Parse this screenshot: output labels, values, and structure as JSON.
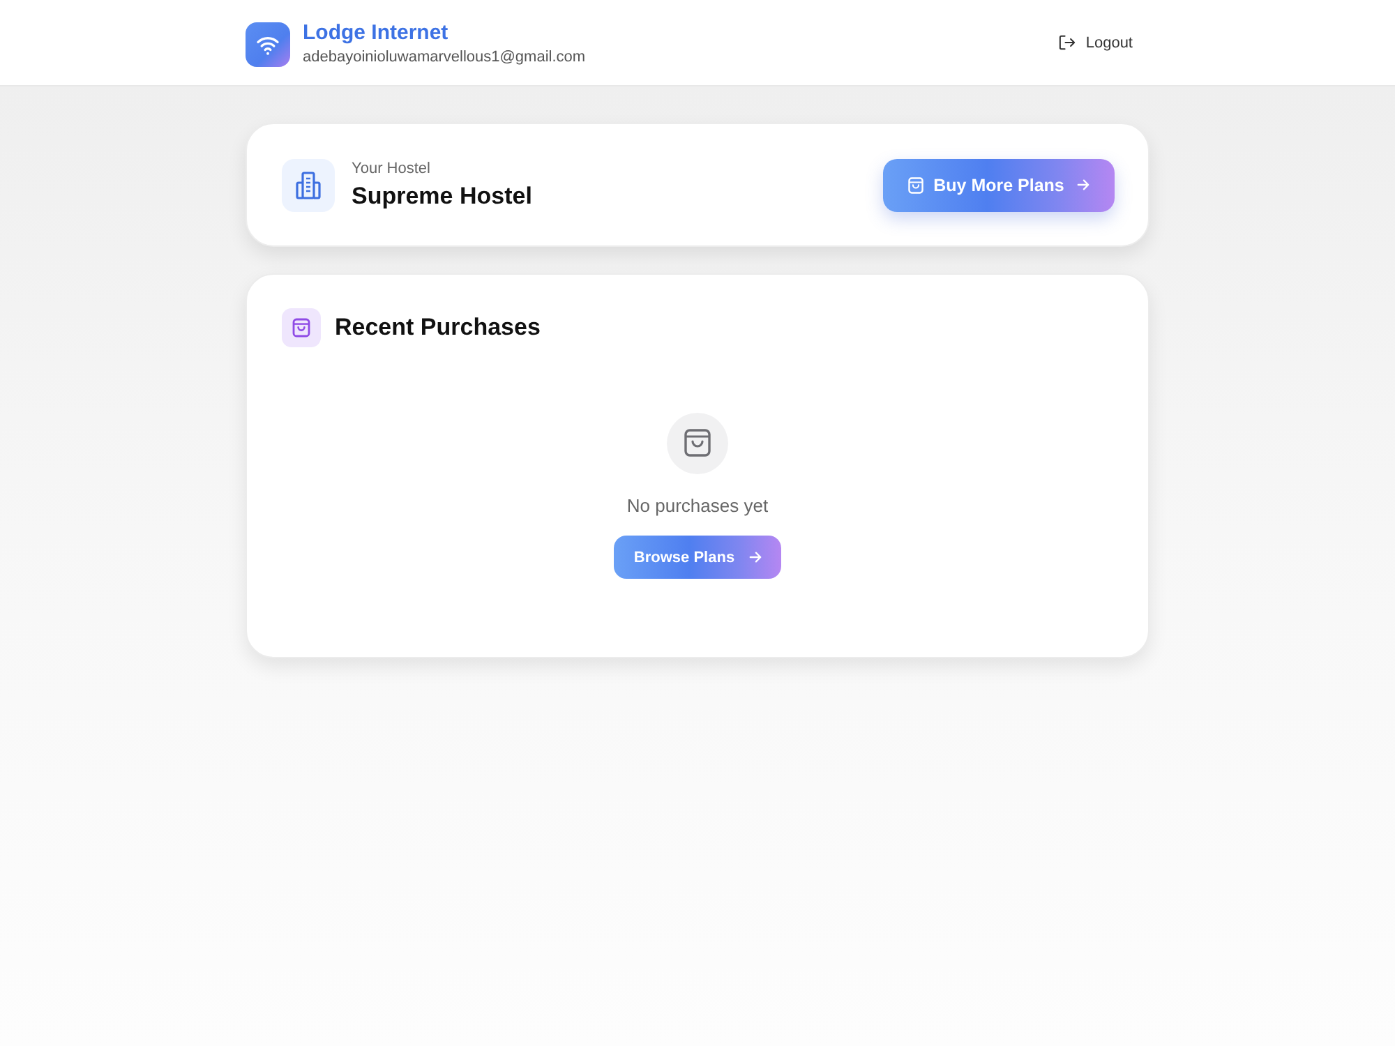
{
  "header": {
    "brand": "Lodge Internet",
    "email": "adebayoinioluwamarvellous1@gmail.com",
    "logout": "Logout"
  },
  "hostel_card": {
    "label": "Your Hostel",
    "name": "Supreme Hostel",
    "button": "Buy More Plans"
  },
  "purchases": {
    "title": "Recent Purchases",
    "empty_text": "No purchases yet",
    "button": "Browse Plans"
  }
}
